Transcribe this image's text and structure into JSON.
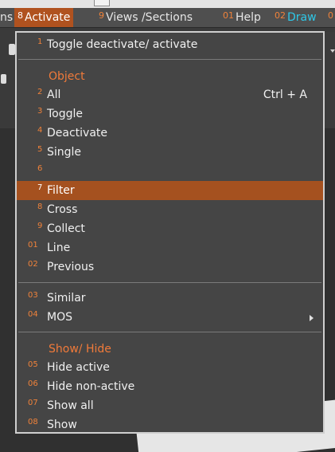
{
  "menubar": {
    "items": [
      {
        "num": "",
        "label": "ns"
      },
      {
        "num": "8",
        "label": "Activate"
      },
      {
        "num": "9",
        "label": "Views /Sections"
      },
      {
        "num": "01",
        "label": "Help"
      },
      {
        "num": "02",
        "label": "Draw"
      },
      {
        "num": "0",
        "label": ""
      }
    ]
  },
  "dropdown": {
    "toggle": {
      "num": "1",
      "label": "Toggle deactivate/ activate"
    },
    "object_header": "Object",
    "object_items": [
      {
        "num": "2",
        "label": "All",
        "shortcut": "Ctrl + A"
      },
      {
        "num": "3",
        "label": "Toggle"
      },
      {
        "num": "4",
        "label": "Deactivate"
      },
      {
        "num": "5",
        "label": "Single"
      },
      {
        "num": "6",
        "label": ""
      },
      {
        "num": "7",
        "label": "Filter"
      },
      {
        "num": "8",
        "label": "Cross"
      },
      {
        "num": "9",
        "label": "Collect"
      },
      {
        "num": "01",
        "label": "Line"
      },
      {
        "num": "02",
        "label": "Previous"
      }
    ],
    "misc_items": [
      {
        "num": "03",
        "label": "Similar"
      },
      {
        "num": "04",
        "label": "MOS"
      }
    ],
    "showhide_header": "Show/ Hide",
    "showhide_items": [
      {
        "num": "05",
        "label": "Hide active"
      },
      {
        "num": "06",
        "label": "Hide non-active"
      },
      {
        "num": "07",
        "label": "Show all"
      },
      {
        "num": "08",
        "label": "Show"
      }
    ]
  },
  "colors": {
    "accent": "#a5511f",
    "number": "#f0823a",
    "draw": "#2ec8e8"
  }
}
